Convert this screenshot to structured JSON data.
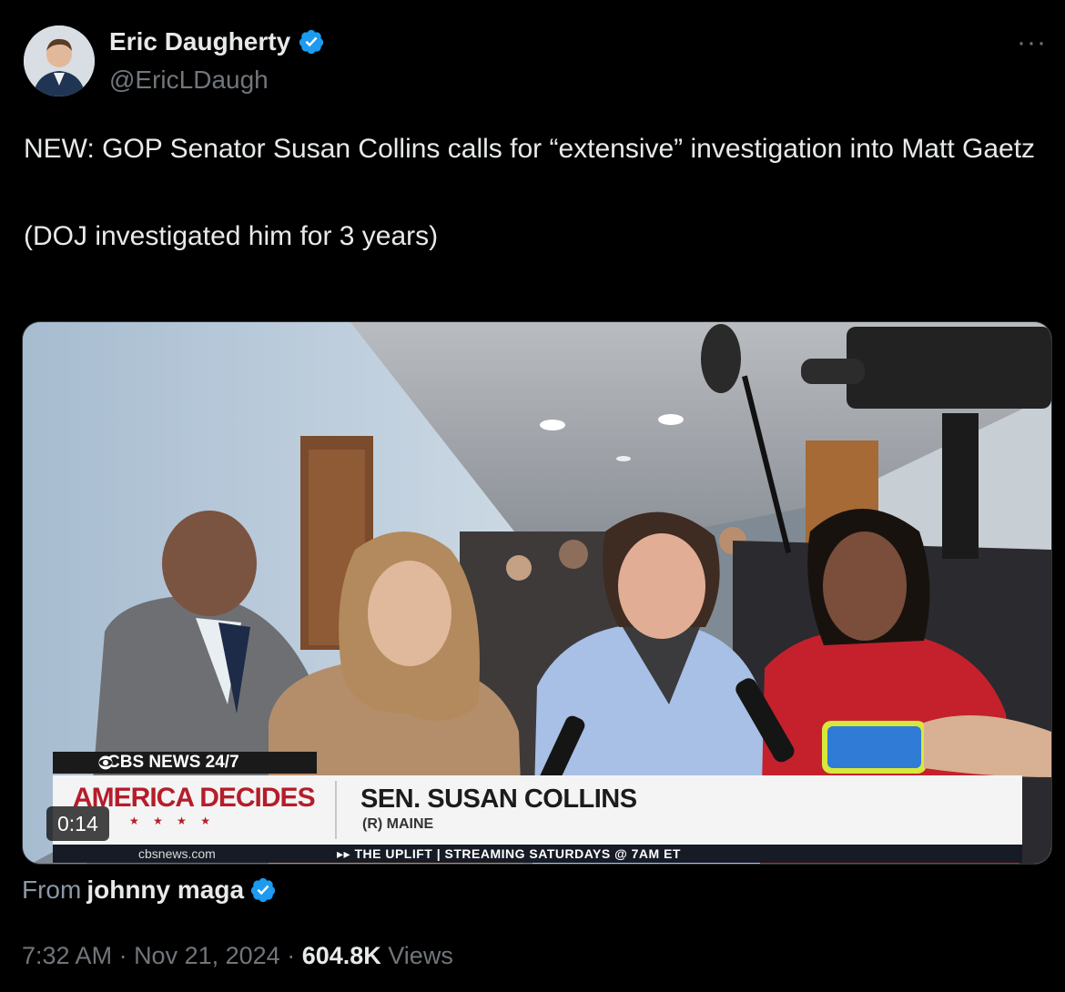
{
  "author": {
    "display_name": "Eric Daugherty",
    "handle": "@EricLDaugh",
    "verified": true
  },
  "more_label": "···",
  "tweet": {
    "text": "NEW: GOP Senator Susan Collins calls for “extensive” investigation into Matt Gaetz\n\n(DOJ investigated him for 3 years)"
  },
  "video": {
    "duration": "0:14",
    "network_tag": "CBS NEWS 24/7",
    "brand": "AMERICA DECIDES",
    "brand_stars": "★ ★ ★ ★",
    "lower_third_name": "SEN. SUSAN COLLINS",
    "lower_third_sub": "(R) MAINE",
    "site": "cbsnews.com",
    "ticker": "▸▸ THE UPLIFT | STREAMING SATURDAYS @ 7AM ET"
  },
  "attribution": {
    "prefix": "From",
    "source_name": "johnny maga",
    "verified": true
  },
  "meta": {
    "time": "7:32 AM",
    "sep1": " · ",
    "date": "Nov 21, 2024",
    "sep2": " · ",
    "views_count": "604.8K",
    "views_label": "Views"
  },
  "colors": {
    "verified_blue": "#1d9bf0",
    "background": "#000000",
    "secondary_text": "#71767b",
    "brand_red": "#b51d2a"
  }
}
